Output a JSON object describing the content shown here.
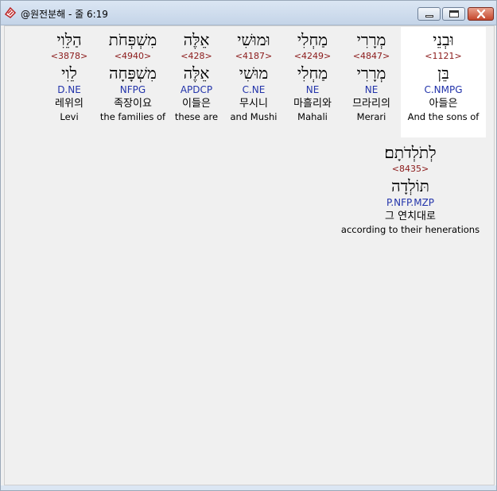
{
  "window": {
    "title": "@원전분해 - 줄 6:19"
  },
  "row1": [
    {
      "heb": "וּבְנֵי",
      "strong": "<1121>",
      "lemma": "בֵּן",
      "morph": "C.NMPG",
      "korean": "아들은",
      "english": "And the sons of"
    },
    {
      "heb": "מְרָרִי",
      "strong": "<4847>",
      "lemma": "מְרָרִי",
      "morph": "NE",
      "korean": "므라리의",
      "english": "Merari"
    },
    {
      "heb": "מַחְלִי",
      "strong": "<4249>",
      "lemma": "מַחְלִי",
      "morph": "NE",
      "korean": "마흘리와",
      "english": "Mahali"
    },
    {
      "heb": "וּמוּשִׁי",
      "strong": "<4187>",
      "lemma": "מוּשִׁי",
      "morph": "C.NE",
      "korean": "무시니",
      "english": "and Mushi"
    },
    {
      "heb": "אֵלֶּה",
      "strong": "<428>",
      "lemma": "אֵלֶּה",
      "morph": "APDCP",
      "korean": "이들은",
      "english": "these are"
    },
    {
      "heb": "מִשְׁפְּחֹת",
      "strong": "<4940>",
      "lemma": "מִשְׁפָּחָה",
      "morph": "NFPG",
      "korean": "족장이요",
      "english": "the families of"
    },
    {
      "heb": "הַלֵּוִי",
      "strong": "<3878>",
      "lemma": "לֵוִי",
      "morph": "D.NE",
      "korean": "레위의",
      "english": "Levi"
    }
  ],
  "row2": [
    {
      "heb": "לְתֹלְדֹתָם׃",
      "strong": "<8435>",
      "lemma": "תּוֹלְדָה",
      "morph": "P.NFP.MZP",
      "korean": "그 연치대로",
      "english": "according to their henerations"
    }
  ]
}
